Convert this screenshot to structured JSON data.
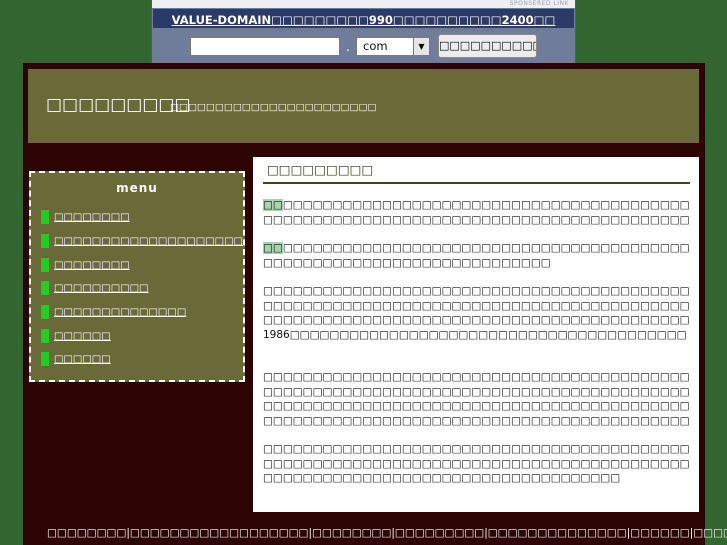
{
  "ad": {
    "sponsored_label": "SPONSERED LINK",
    "headline": "VALUE-DOMAIN□□□□□□□□□990□□□□□□□□□□2400□□",
    "domain_input_value": "",
    "dot": ".",
    "tld_value": "com",
    "tld_arrow": "▼",
    "search_button_label": "□□□□□□□□□□□□!!"
  },
  "header": {
    "site_title": "□□□□□□□□□",
    "site_subtitle": "□□□□□□□□□□□□□□□□□□□□□□□"
  },
  "sidebar": {
    "menu_title": "menu",
    "items": [
      {
        "label": "□□□□□□□□"
      },
      {
        "label": "□□□□□□□□□□□□□□□□□□□□"
      },
      {
        "label": "□□□□□□□□"
      },
      {
        "label": "□□□□□□□□□□"
      },
      {
        "label": "□□□□□□□□□□□□□□"
      },
      {
        "label": "□□□□□□"
      },
      {
        "label": "□□□□□□"
      }
    ]
  },
  "content": {
    "title": "□□□□□□□□□",
    "paragraphs": [
      {
        "mark": "□□",
        "text": "□□□□□□□□□□□□□□□□□□□□□□□□□□□□□□□□□□□□□□□□□□□□□□□□□□□□□□□□□□□□□□□□□□□□□□□□□□□□□□□□□□□□□□□□□□□□□"
      },
      {
        "mark": "□□",
        "text": "□□□□□□□□□□□□□□□□□□□□□□□□□□□□□□□□□□□□□□□□□□□□□□□□□□□□□□□□□□□□□□□□□□□□□□"
      },
      {
        "mark": "",
        "text": "□□□□□□□□□□□□□□□□□□□□□□□□□□□□□□□□□□□□□□□□□□□□□□□□□□□□□□□□□□□□□□□□□□□□□□□□□□□□□□□□□□□□□□□□□□□□□□□□□□□□□□□□□□□□□□□□□□□□□□□□□□□□□□□□□1986□□□□□□□□□□□□□□□□□□□□□□□□□□□□□□□□□□□□□□□□□□□□□□□□□□□□□□□□□"
      },
      {
        "mark": "",
        "text": "□□□□□□□□□□□□□□□□□□□□□□□□□□□□□□□□□□□□□□□□□□□□□□□□□□□□□□□□□□□□□□□□□□□□□□□□□□□□□□□□□□□□□□□□□□□□□□□□□□□□□□□□□□□□□□□□□□□□□□□□□□□□□□□□□□□□□□□□□□□□□□□□□□□□□□□□□□□□□□□□□□□□□□□□□□□□□□"
      },
      {
        "mark": "",
        "text": "□□□□□□□□□□□□□□□□□□□□□□□□□□□□□□□□□□□□□□□□□□□□□□□□□□□□□□□□□□□□□□□□□□□□□□□□□□□□□□□□□□□□□□□□□□□□□□□□□□□□□□□□□□□□□□□□□□□□□□□□□□"
      }
    ]
  },
  "footer": {
    "text": "□□□□□□□□|□□□□□□□□□□□□□□□□□□|□□□□□□□□|□□□□□□□□□|□□□□□□□□□□□□□□|□□□□□□|□□□□□□|"
  }
}
